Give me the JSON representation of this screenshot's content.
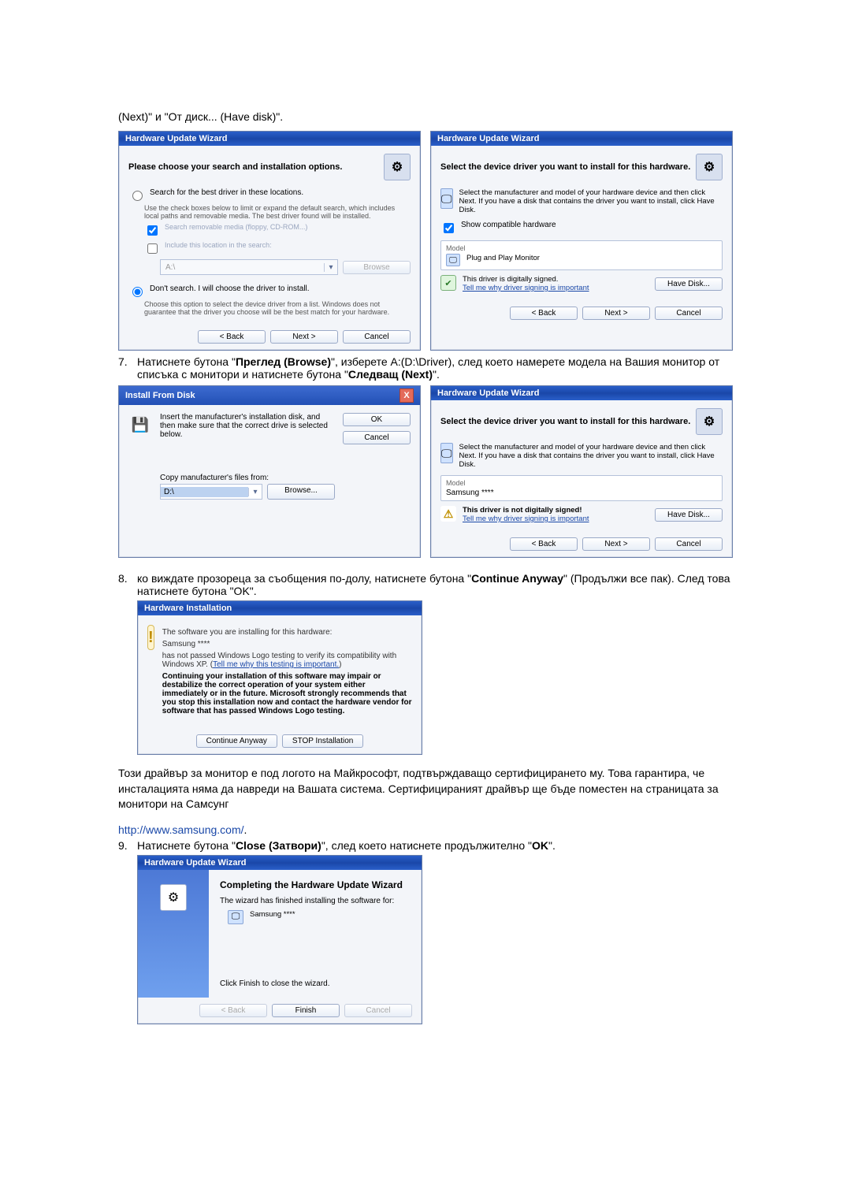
{
  "intro": {
    "text": "(Next)\" и \"От диск... (Have disk)\"."
  },
  "dlg_search": {
    "title": "Hardware Update Wizard",
    "heading": "Please choose your search and installation options.",
    "radio1": "Search for the best driver in these locations.",
    "radio1_sub": "Use the check boxes below to limit or expand the default search, which includes local paths and removable media. The best driver found will be installed.",
    "chk1": "Search removable media (floppy, CD-ROM...)",
    "chk2": "Include this location in the search:",
    "combo_placeholder": "A:\\",
    "browse": "Browse",
    "radio2": "Don't search. I will choose the driver to install.",
    "radio2_sub": "Choose this option to select the device driver from a list. Windows does not guarantee that the driver you choose will be the best match for your hardware.",
    "back": "< Back",
    "next": "Next >",
    "cancel": "Cancel"
  },
  "dlg_select1": {
    "title": "Hardware Update Wizard",
    "heading": "Select the device driver you want to install for this hardware.",
    "info": "Select the manufacturer and model of your hardware device and then click Next. If you have a disk that contains the driver you want to install, click Have Disk.",
    "show_compat": "Show compatible hardware",
    "model_label": "Model",
    "model_item": "Plug and Play Monitor",
    "signed": "This driver is digitally signed.",
    "tell_me": "Tell me why driver signing is important",
    "have_disk": "Have Disk...",
    "back": "< Back",
    "next": "Next >",
    "cancel": "Cancel"
  },
  "step7": {
    "num": "7.",
    "text_a": "Натиснете бутона \"",
    "bold_a": "Преглед (Browse)",
    "text_b": "\", изберете A:(D:\\Driver), след което намерете модела на Вашия монитор от списъка с монитори и натиснете бутона \"",
    "bold_b": "Следващ (Next)",
    "text_c": "\"."
  },
  "dlg_ifd": {
    "title": "Install From Disk",
    "msg": "Insert the manufacturer's installation disk, and then make sure that the correct drive is selected below.",
    "ok": "OK",
    "cancel": "Cancel",
    "copy_label": "Copy manufacturer's files from:",
    "combo_value": "D:\\",
    "browse": "Browse..."
  },
  "dlg_select2": {
    "title": "Hardware Update Wizard",
    "heading": "Select the device driver you want to install for this hardware.",
    "info": "Select the manufacturer and model of your hardware device and then click Next. If you have a disk that contains the driver you want to install, click Have Disk.",
    "model_label": "Model",
    "model_item": "Samsung ****",
    "not_signed": "This driver is not digitally signed!",
    "tell_me": "Tell me why driver signing is important",
    "have_disk": "Have Disk...",
    "back": "< Back",
    "next": "Next >",
    "cancel": "Cancel"
  },
  "step8": {
    "num": "8.",
    "text_a": "ко виждате прозореца за съобщения по-долу, натиснете бутона \"",
    "bold_a": "Continue Anyway",
    "text_b": "\" (Продължи все пак). След това натиснете бутона \"OK\"."
  },
  "dlg_hwinst": {
    "title": "Hardware Installation",
    "line1": "The software you are installing for this hardware:",
    "device": "Samsung ****",
    "line2a": "has not passed Windows Logo testing to verify its compatibility with Windows XP. (",
    "link": "Tell me why this testing is important.",
    "line2b": ")",
    "warn": "Continuing your installation of this software may impair or destabilize the correct operation of your system either immediately or in the future. Microsoft strongly recommends that you stop this installation now and contact the hardware vendor for software that has passed Windows Logo testing.",
    "continue": "Continue Anyway",
    "stop": "STOP Installation"
  },
  "mid_para": "Този драйвър за монитор е под логото на Майкрософт, подтвърждаващо сертифицирането му. Това гарантира, че инсталацията няма да навреди на Вашата система. Сертифицираният драйвър ще бъде поместен на страницата за монитори на Самсунг",
  "url": "http://www.samsung.com/",
  "url_dot": ".",
  "step9": {
    "num": "9.",
    "text_a": "Натиснете бутона \"",
    "bold_a": "Close (Затвори)",
    "text_b": "\", след което натиснете продължително \"",
    "bold_b": "OK",
    "text_c": "\"."
  },
  "dlg_done": {
    "title": "Hardware Update Wizard",
    "heading": "Completing the Hardware Update Wizard",
    "line1": "The wizard has finished installing the software for:",
    "device": "Samsung ****",
    "line2": "Click Finish to close the wizard.",
    "back": "< Back",
    "finish": "Finish",
    "cancel": "Cancel"
  }
}
